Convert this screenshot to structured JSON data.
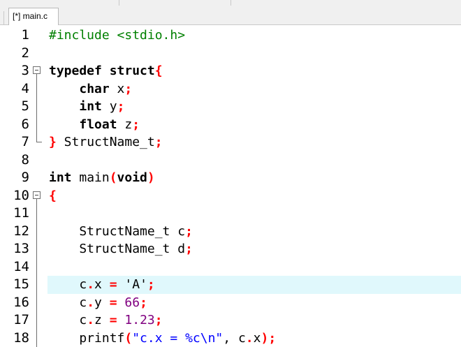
{
  "tab": {
    "label": "[*] main.c"
  },
  "colors": {
    "current_line_bg": "#e0f8fc",
    "keyword": "#000000",
    "preprocessor": "#008000",
    "brace": "#ff0000",
    "string": "#0000ff",
    "number": "#800080"
  },
  "editor": {
    "current_line": 15,
    "lines": [
      {
        "num": "1",
        "tokens": [
          {
            "t": "#include <stdio.h>",
            "c": "pp"
          }
        ]
      },
      {
        "num": "2",
        "tokens": []
      },
      {
        "num": "3",
        "fold": "start",
        "tokens": [
          {
            "t": "typedef",
            "c": "kw"
          },
          {
            "t": " "
          },
          {
            "t": "struct",
            "c": "kw"
          },
          {
            "t": "{",
            "c": "br"
          }
        ]
      },
      {
        "num": "4",
        "fold": "mid",
        "tokens": [
          {
            "t": "    "
          },
          {
            "t": "char",
            "c": "kw"
          },
          {
            "t": " x"
          },
          {
            "t": ";",
            "c": "pn"
          }
        ]
      },
      {
        "num": "5",
        "fold": "mid",
        "tokens": [
          {
            "t": "    "
          },
          {
            "t": "int",
            "c": "kw"
          },
          {
            "t": " y"
          },
          {
            "t": ";",
            "c": "pn"
          }
        ]
      },
      {
        "num": "6",
        "fold": "mid",
        "tokens": [
          {
            "t": "    "
          },
          {
            "t": "float",
            "c": "kw"
          },
          {
            "t": " z"
          },
          {
            "t": ";",
            "c": "pn"
          }
        ]
      },
      {
        "num": "7",
        "fold": "end",
        "tokens": [
          {
            "t": "}",
            "c": "br"
          },
          {
            "t": " StructName_t"
          },
          {
            "t": ";",
            "c": "pn"
          }
        ]
      },
      {
        "num": "8",
        "tokens": []
      },
      {
        "num": "9",
        "tokens": [
          {
            "t": "int",
            "c": "kw"
          },
          {
            "t": " main"
          },
          {
            "t": "(",
            "c": "br"
          },
          {
            "t": "void",
            "c": "kw"
          },
          {
            "t": ")",
            "c": "br"
          }
        ]
      },
      {
        "num": "10",
        "fold": "start",
        "tokens": [
          {
            "t": "{",
            "c": "br"
          }
        ]
      },
      {
        "num": "11",
        "fold": "mid",
        "tokens": []
      },
      {
        "num": "12",
        "fold": "mid",
        "tokens": [
          {
            "t": "    StructName_t c"
          },
          {
            "t": ";",
            "c": "pn"
          }
        ]
      },
      {
        "num": "13",
        "fold": "mid",
        "tokens": [
          {
            "t": "    StructName_t d"
          },
          {
            "t": ";",
            "c": "pn"
          }
        ]
      },
      {
        "num": "14",
        "fold": "mid",
        "tokens": []
      },
      {
        "num": "15",
        "fold": "mid",
        "tokens": [
          {
            "t": "    c"
          },
          {
            "t": ".",
            "c": "pn"
          },
          {
            "t": "x "
          },
          {
            "t": "=",
            "c": "pn"
          },
          {
            "t": " 'A'"
          },
          {
            "t": ";",
            "c": "pn"
          }
        ]
      },
      {
        "num": "16",
        "fold": "mid",
        "tokens": [
          {
            "t": "    c"
          },
          {
            "t": ".",
            "c": "pn"
          },
          {
            "t": "y "
          },
          {
            "t": "=",
            "c": "pn"
          },
          {
            "t": " "
          },
          {
            "t": "66",
            "c": "nm"
          },
          {
            "t": ";",
            "c": "pn"
          }
        ]
      },
      {
        "num": "17",
        "fold": "mid",
        "tokens": [
          {
            "t": "    c"
          },
          {
            "t": ".",
            "c": "pn"
          },
          {
            "t": "z "
          },
          {
            "t": "=",
            "c": "pn"
          },
          {
            "t": " "
          },
          {
            "t": "1.23",
            "c": "nm"
          },
          {
            "t": ";",
            "c": "pn"
          }
        ]
      },
      {
        "num": "18",
        "fold": "mid",
        "tokens": [
          {
            "t": "    printf"
          },
          {
            "t": "(",
            "c": "br"
          },
          {
            "t": "\"c.x = %c\\n\"",
            "c": "st"
          },
          {
            "t": ", c"
          },
          {
            "t": ".",
            "c": "pn"
          },
          {
            "t": "x"
          },
          {
            "t": ")",
            "c": "br"
          },
          {
            "t": ";",
            "c": "pn"
          }
        ]
      }
    ]
  }
}
